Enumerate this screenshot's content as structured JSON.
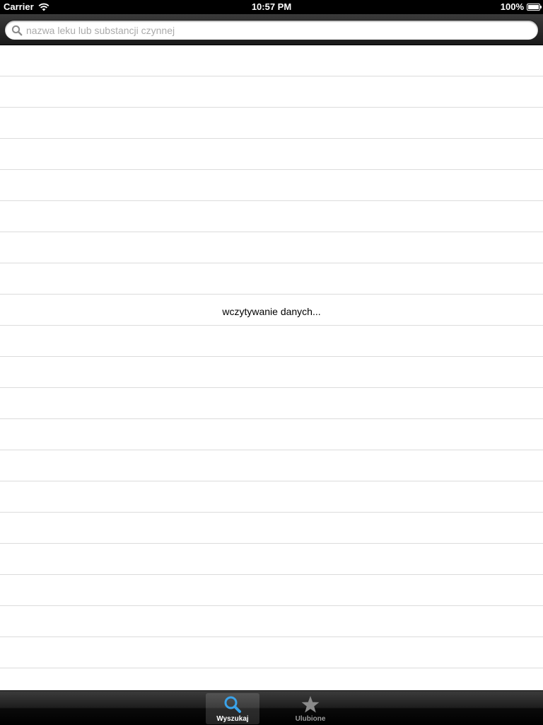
{
  "status_bar": {
    "carrier": "Carrier",
    "time": "10:57 PM",
    "battery": "100%"
  },
  "search": {
    "placeholder": "nazwa leku lub substancji czynnej",
    "value": ""
  },
  "table": {
    "loading_text": "wczytywanie danych..."
  },
  "tab_bar": {
    "tabs": [
      {
        "label": "Wyszukaj",
        "icon": "search-icon",
        "selected": true
      },
      {
        "label": "Ulubione",
        "icon": "star-icon",
        "selected": false
      }
    ]
  },
  "colors": {
    "tab_selected_icon": "#3aa3ea",
    "tab_unselected_icon": "#8a8a8a"
  }
}
